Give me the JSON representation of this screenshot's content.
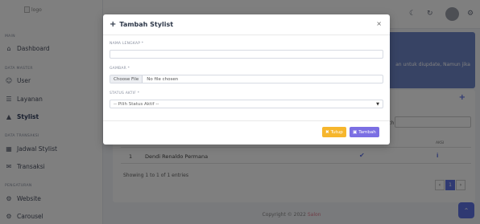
{
  "sidebar": {
    "logo_alt": "logo",
    "sections": {
      "main": "MAIN",
      "data_master": "DATA MASTER",
      "data_transaksi": "DATA TRANSAKSI",
      "pengaturan": "PENGATURAN"
    },
    "items": {
      "dashboard": "Dashboard",
      "user": "User",
      "layanan": "Layanan",
      "stylist": "Stylist",
      "jadwal_stylist": "Jadwal Stylist",
      "transaksi": "Transaksi",
      "website": "Website",
      "carousel": "Carousel"
    }
  },
  "background": {
    "banner_text": "an untuk diupdate, Namun jika",
    "search_label": "rch",
    "table": {
      "header_aksi": "AKSI",
      "rows": [
        {
          "no": "1",
          "name": "Dendi Renaldo Permana"
        }
      ]
    },
    "showing": "Showing 1 to 1 of 1 entries",
    "page": "1",
    "footer_prefix": "Copyright © 2022",
    "footer_brand": "Salon"
  },
  "modal": {
    "title": "Tambah Stylist",
    "close": "×",
    "fields": {
      "nama": {
        "label": "NAMA LENGKAP *",
        "value": ""
      },
      "gambar": {
        "label": "GAMBAR *",
        "button": "Choose File",
        "status": "No file chosen"
      },
      "status": {
        "label": "STATUS AKTIF *",
        "selected": "-- Pilih Status Aktif --"
      }
    },
    "buttons": {
      "tutup": "Tutup",
      "tambah": "Tambah"
    }
  },
  "colors": {
    "accent": "#5e72e4",
    "tutup": "#f6b62d",
    "tambah": "#7b6fe3"
  }
}
